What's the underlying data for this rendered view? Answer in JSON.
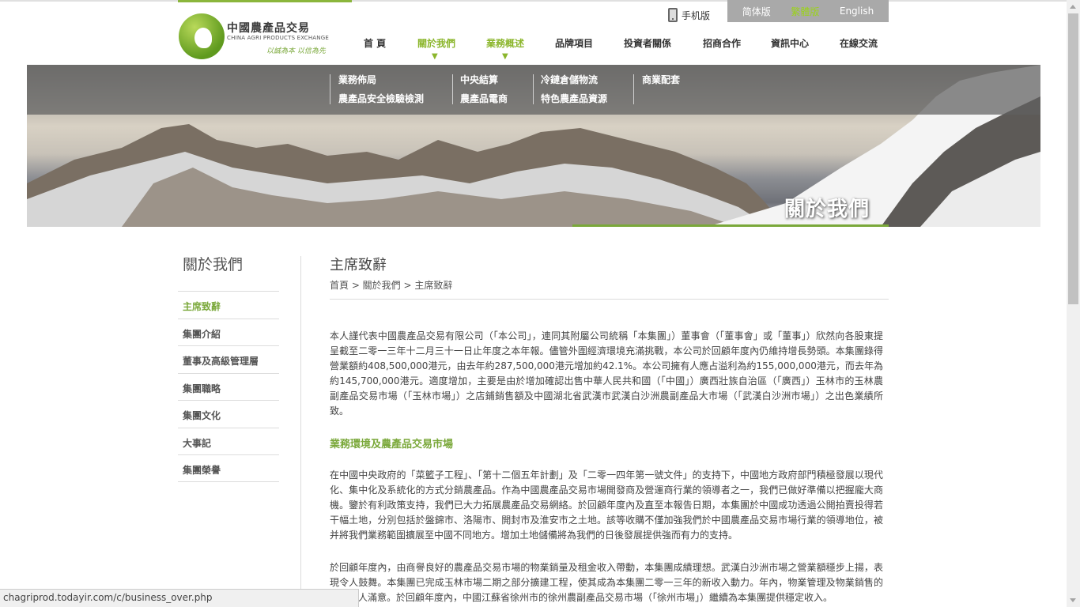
{
  "logo": {
    "cn": "中國農產品交易",
    "en": "CHINA AGRI PRODUCTS EXCHANGE",
    "slogan": "以誠為本 以信為先"
  },
  "mobile_label": "手机版",
  "languages": [
    "简体版",
    "繁體版",
    "English"
  ],
  "nav": [
    "首 頁",
    "關於我們",
    "業務概述",
    "品牌項目",
    "投資者關係",
    "招商合作",
    "資訊中心",
    "在線交流"
  ],
  "submenu": [
    "業務佈局",
    "中央結算",
    "冷鏈倉儲物流",
    "商業配套",
    "農產品安全檢驗檢測",
    "農產品電商",
    "特色農產品資源"
  ],
  "banner_title": "關於我們",
  "sidebar": {
    "title": "關於我們",
    "items": [
      "主席致辭",
      "集團介紹",
      "董事及高級管理層",
      "集團職略",
      "集團文化",
      "大事記",
      "集團榮譽"
    ]
  },
  "content": {
    "title": "主席致辭",
    "breadcrumb": "首頁 > 關於我們 > 主席致辭",
    "para1": "本人謹代表中國農產品交易有限公司（「本公司」，連同其附屬公司統稱「本集團」）董事會（「董事會」或「董事」）欣然向各股東提呈截至二零一三年十二月三十一日止年度之本年報。儘管外圍經濟環境充滿挑戰，本公司於回顧年度內仍維持增長勢頭。本集團錄得營業額約408,500,000港元，由去年約287,500,000港元增加約42.1%。本公司擁有人應占溢利為約155,000,000港元，而去年為約145,700,000港元。適度增加，主要是由於增加確認出售中華人民共和國（「中國」）廣西壯族自治區（「廣西」）玉林市的玉林農副產品交易市場（「玉林市場」）之店鋪銷售額及中國湖北省武漢市武漢白沙洲農副產品大市場（「武漢白沙洲市場」）之出色業績所致。",
    "section_heading": "業務環境及農產品交易市場",
    "para2": "在中國中央政府的「菜籃子工程」、「第十二個五年計劃」及「二零一四年第一號文件」的支持下，中國地方政府部門積極發展以現代化、集中化及系統化的方式分銷農產品。作為中國農產品交易市場開發商及營運商行業的領導者之一，我們已做好準備以把握龐大商機。鑒於有利政策支持，我們已大力拓展農產品交易網絡。於回顧年度內及直至本報告日期，本集團於中國成功透過公開拍賣投得若干幅土地，分別包括於盤錦市、洛陽市、開封市及淮安市之土地。該等收購不僅加強我們於中國農產品交易市場行業的領導地位，被并將我們業務範圍擴展至中國不同地方。增加土地儲備將為我們的日後發展提供強而有力的支持。",
    "para3": "於回顧年度內，由商譽良好的農產品交易市場的物業銷量及租金收入帶動，本集團成績理想。武漢白沙洲市場之營業額穩步上揚，表現令人鼓舞。本集團已完成玉林市場二期之部分擴建工程，使其成為本集團二零一三年的新收入動力。年內，物業管理及物業銷售的表現令人滿意。於回顧年度內，中國江蘇省徐州市的徐州農副產品交易市場（「徐州市場」）繼續為本集團提供穩定收入。"
  },
  "status_url": "chagriprod.todayir.com/c/business_over.php",
  "colors": {
    "accent": "#7aa83a",
    "lang_bar": "#a9a9a9",
    "active_lang": "#9bd21b"
  }
}
